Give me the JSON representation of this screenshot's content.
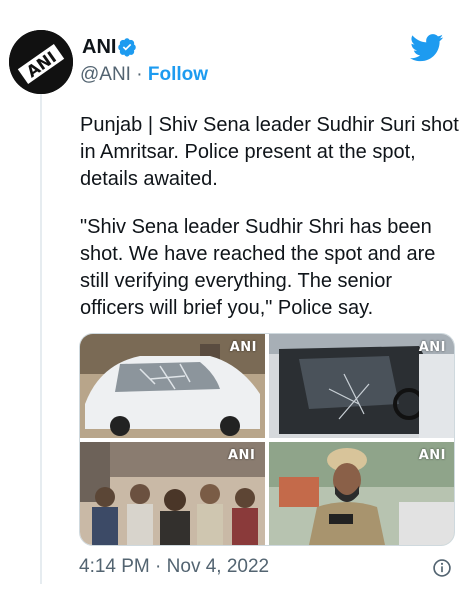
{
  "author": {
    "name": "ANI",
    "handle": "@ANI",
    "separator": "·",
    "follow_label": "Follow",
    "avatar_text": "ANI"
  },
  "tweet": {
    "paragraphs": [
      "Punjab | Shiv Sena leader Sudhir Suri shot in Amritsar. Police present at the spot, details awaited.",
      "\"Shiv Sena leader Sudhir Shri has been shot. We have reached the spot and are still verifying everything. The senior officers will brief you,\" Police say."
    ]
  },
  "media": {
    "images": [
      {
        "watermark": "ANI",
        "depicts": "damaged white car with shattered windshield"
      },
      {
        "watermark": "ANI",
        "depicts": "car interior with broken window glass"
      },
      {
        "watermark": "ANI",
        "depicts": "crowd of people and police on street"
      },
      {
        "watermark": "ANI",
        "depicts": "police officer in turban at scene"
      }
    ]
  },
  "footer": {
    "time": "4:14 PM",
    "separator": "·",
    "date": "Nov 4, 2022"
  },
  "colors": {
    "accent": "#1d9bf0",
    "text": "#0f1419",
    "muted": "#536471"
  },
  "icons": {
    "platform": "twitter-bird-icon",
    "verified": "verified-badge-icon",
    "info": "info-icon"
  }
}
